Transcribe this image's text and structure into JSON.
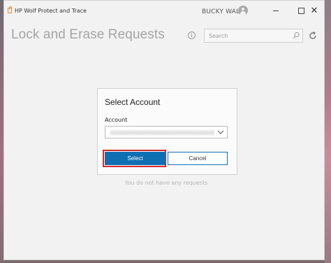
{
  "window": {
    "app_title": "HP Wolf Protect and Trace",
    "user_name": "BUCKY WALL",
    "controls": {
      "minimize": "—",
      "maximize": "☐",
      "close": "✕"
    }
  },
  "header": {
    "title": "Lock and Erase Requests",
    "info_glyph": "i",
    "search_placeholder": "Search"
  },
  "dialog": {
    "title": "Select Account",
    "account_label": "Account",
    "account_value": "xxxxxxxxxxxxxxxxxxxxxxxxxxxxxxxxxxxx",
    "select_label": "Select",
    "cancel_label": "Cancel"
  },
  "main": {
    "empty_message": "You do not have any requests"
  },
  "colors": {
    "accent": "#0f6fb3",
    "highlight": "#d32b2b",
    "title_gray": "#a5a5a5",
    "app_icon": "#e08a2e"
  },
  "icons": [
    "lock-icon",
    "user-avatar-icon",
    "info-icon",
    "search-icon",
    "refresh-icon",
    "chevron-down-icon"
  ]
}
